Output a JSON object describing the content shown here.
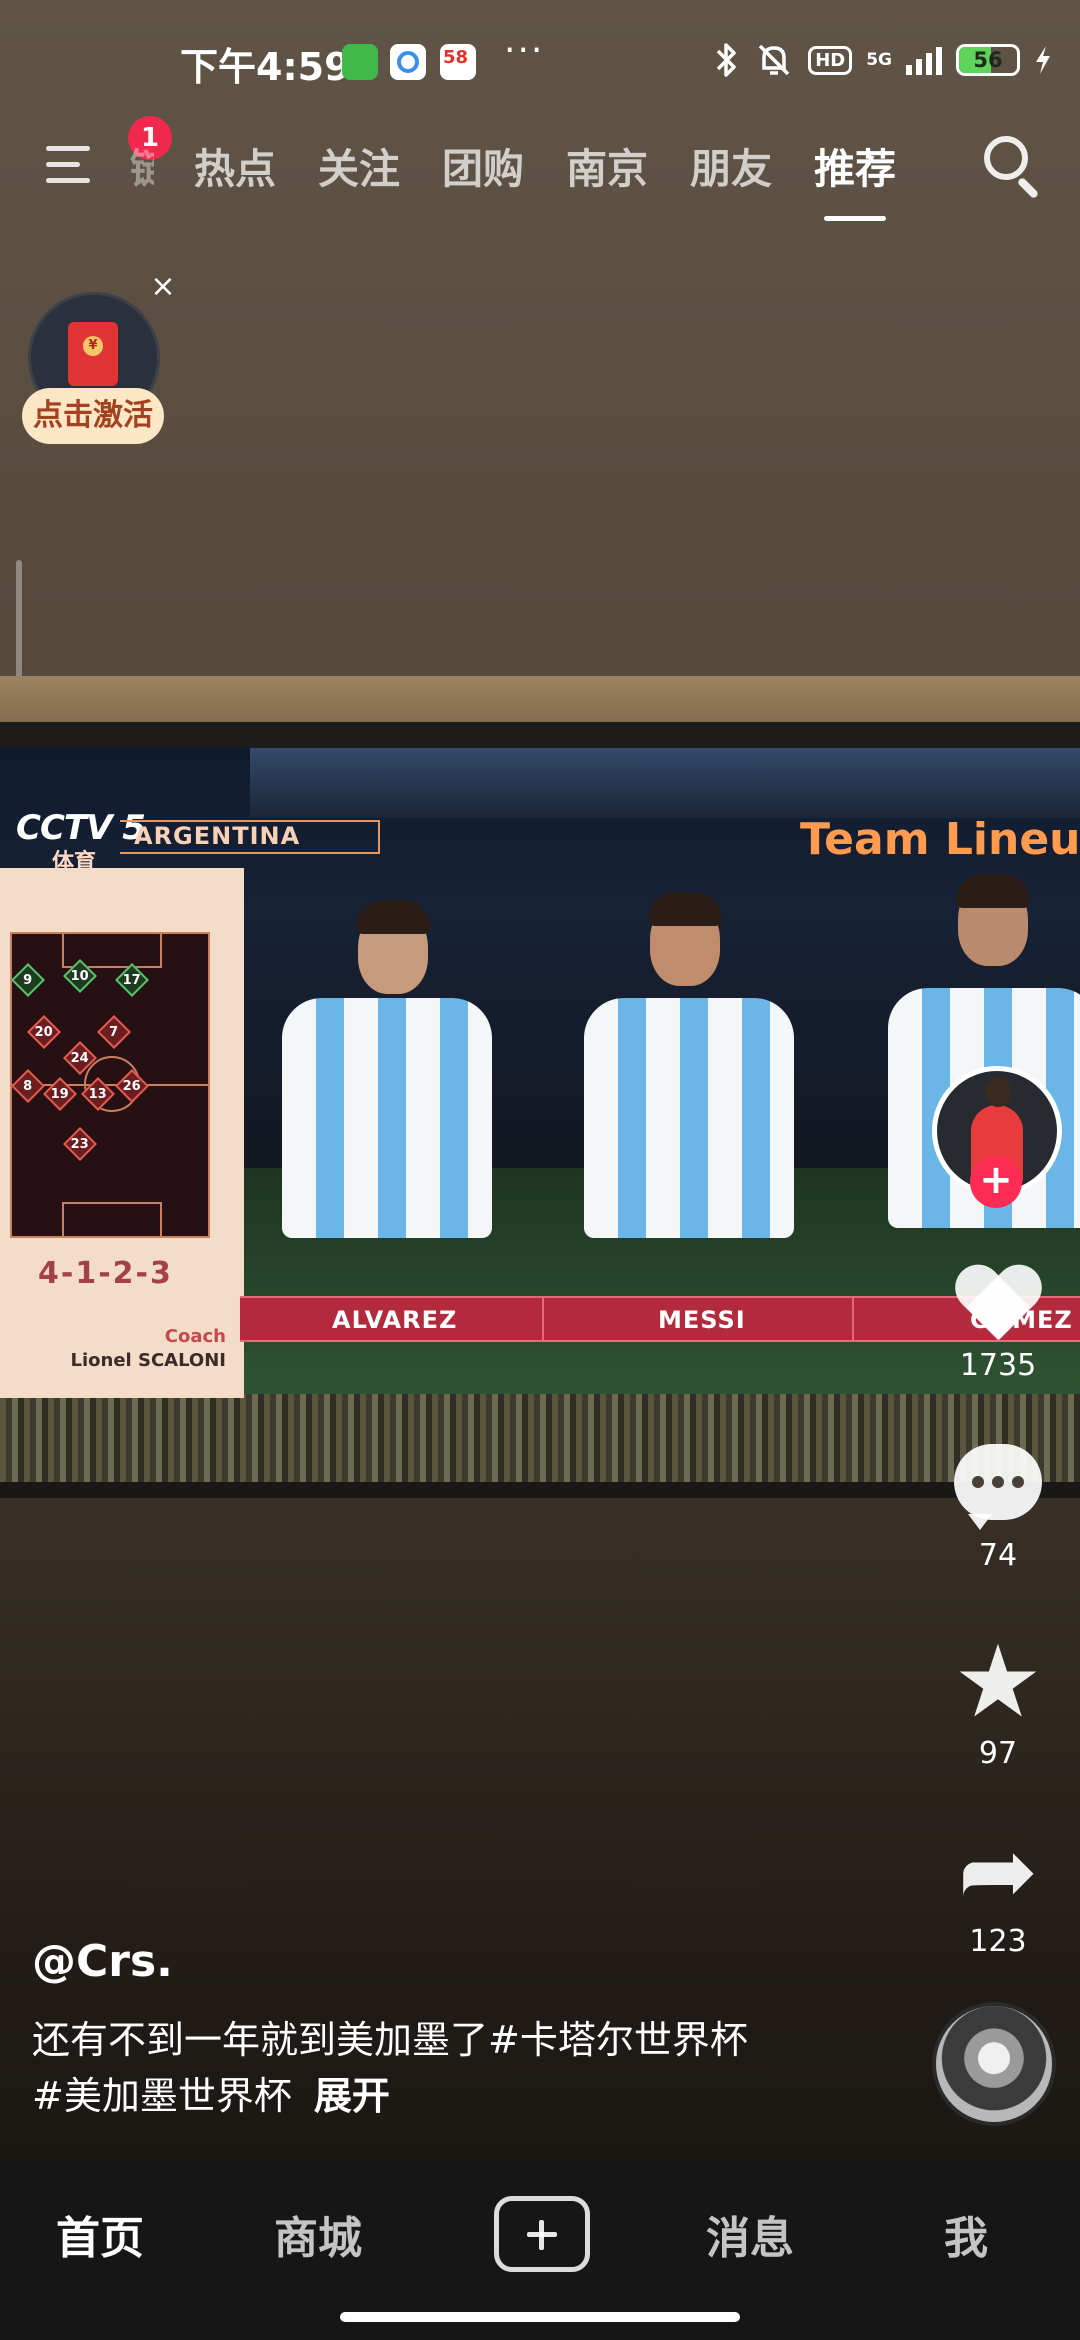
{
  "status_bar": {
    "time": "下午4:59",
    "more": "···",
    "hd": "HD",
    "network": "5G",
    "battery": "56",
    "battery_level": 0.56,
    "icons": [
      "wechat-app-icon",
      "baidu-app-icon",
      "58-app-icon",
      "bluetooth-icon",
      "mute-bell-icon",
      "signal-icon",
      "charging-icon"
    ]
  },
  "top_nav": {
    "badge_count": "1",
    "tabs": [
      {
        "label": "热点",
        "active": false
      },
      {
        "label": "关注",
        "active": false
      },
      {
        "label": "团购",
        "active": false
      },
      {
        "label": "南京",
        "active": false
      },
      {
        "label": "朋友",
        "active": false
      },
      {
        "label": "推荐",
        "active": true
      }
    ],
    "partial_tab": "链"
  },
  "float_widget": {
    "button_label": "点击激活",
    "close": "×"
  },
  "video": {
    "channel": "CCTV 5",
    "channel_sub": "体育",
    "team": "ARGENTINA",
    "title": "Team Lineu",
    "formation": "4-1-2-3",
    "coach_role": "Coach",
    "coach_name": "Lionel SCALONI",
    "player_names": [
      "ALVAREZ",
      "MESSI",
      "GOMEZ"
    ],
    "formation_numbers": [
      "9",
      "10",
      "17",
      "20",
      "7",
      "24",
      "8",
      "19",
      "13",
      "26",
      "23"
    ]
  },
  "actions": {
    "follow": "+",
    "likes": "1735",
    "comments": "74",
    "favorites": "97",
    "shares": "123"
  },
  "post": {
    "author": "@Crs.",
    "caption_line1": "还有不到一年就到美加墨了#卡塔尔世界杯",
    "caption_line2": "#美加墨世界杯",
    "expand": "展开"
  },
  "bottom_nav": {
    "home": "首页",
    "mall": "商城",
    "messages": "消息",
    "me": "我"
  },
  "colors": {
    "accent": "#fe2c55",
    "badge": "#f1284d",
    "lineup_title": "#ff9b4f",
    "name_strip": "#b32a3c"
  }
}
